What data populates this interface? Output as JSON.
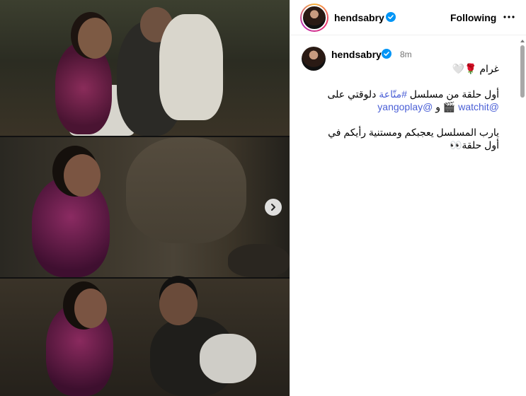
{
  "post": {
    "username": "hendsabry",
    "follow_status": "Following",
    "more_icon": "more-horizontal-icon",
    "verified_icon": "verified-badge-icon",
    "next_icon": "chevron-right-icon"
  },
  "caption": {
    "username": "hendsabry",
    "time": "8m",
    "line1": "غرام 🌹🤍",
    "line2_pre": "أول حلقة من مسلسل ",
    "line2_tag": "#متّاعة",
    "line2_post": " دلوقتي على",
    "line3_mention1": "@watchit",
    "line3_mid": " و ",
    "line3_mention2": "@yangoplay",
    "line3_emoji": "🎬 ",
    "line4": "يارب المسلسل يعجبكم ومستنية رأيكم في",
    "line5": "أول حلقة👀"
  },
  "colors": {
    "accent_link": "#4a5fd6",
    "verified_blue": "#0095f6",
    "muted_text": "#737373"
  }
}
